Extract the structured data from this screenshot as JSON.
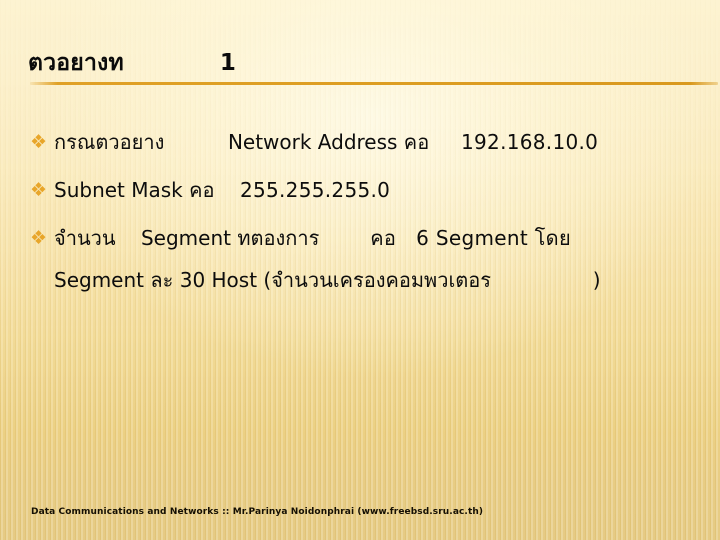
{
  "slide": {
    "title": {
      "text": "ตวอยางท",
      "number": "1"
    },
    "bullets": [
      {
        "marker": "❖",
        "marker_name": "diamond-cluster-bullet-icon",
        "label_thai": "กรณตวอยาง",
        "gap1": "          ",
        "label_latin": "Network Address",
        "connector": " คอ",
        "gap2": "     ",
        "value": "192.168.10.0"
      },
      {
        "marker": "❖",
        "marker_name": "diamond-cluster-bullet-icon",
        "label_thai": "",
        "gap1": "",
        "label_latin": "Subnet Mask",
        "connector": " คอ",
        "gap2": "    ",
        "value": "255.255.255.0"
      },
      {
        "marker": "❖",
        "marker_name": "diamond-cluster-bullet-icon",
        "label_thai": "จำนวน",
        "gap1": "    ",
        "label_latin": "Segment",
        "connector": " ทตองการ",
        "gap2": "        ",
        "value": "คอ   6 Segment โดย"
      }
    ],
    "continuation": "Segment ละ 30 Host (จำนวนเครองคอมพวเตอร                )",
    "footer": "Data Communications and Networks :: Mr.Parinya Noidonphrai (www.freebsd.sru.ac.th)",
    "colors": {
      "rule": "#dd9e22",
      "bullet": "#e8a62a",
      "text": "#0d0d0d",
      "background_top": "#fdf3d2",
      "background_bottom": "#e8ce88"
    }
  }
}
